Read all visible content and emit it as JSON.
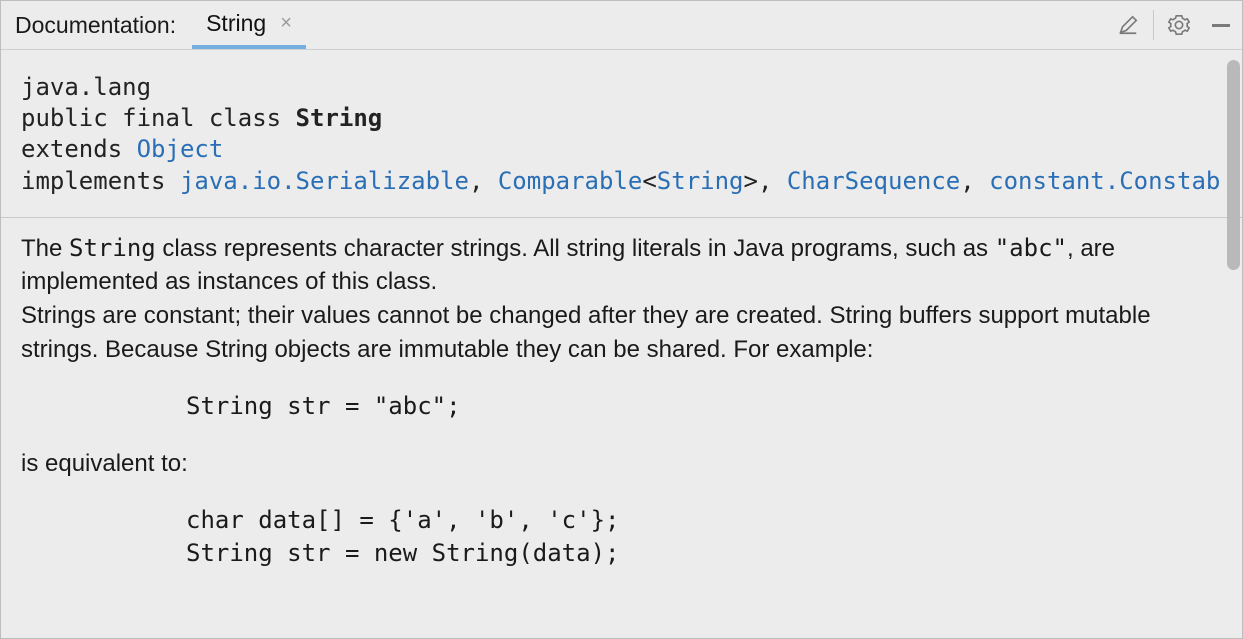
{
  "header": {
    "title": "Documentation:",
    "tab_label": "String"
  },
  "signature": {
    "package": "java.lang",
    "modifiers": "public final class",
    "class_name": "String",
    "extends_kw": "extends",
    "extends_link": "Object",
    "implements_kw": "implements",
    "impl1": "java.io.Serializable",
    "comma": ", ",
    "impl2": "Comparable",
    "lt": "<",
    "impl2_param": "String",
    "gt": ">",
    "impl3": "CharSequence",
    "impl4": "constant.Constab"
  },
  "desc": {
    "p1a": "The ",
    "p1code": "String",
    "p1b": " class represents character strings. All string literals in Java programs, such as ",
    "p1lit": "\"abc\"",
    "p1c": ", are implemented as instances of this class.",
    "p2": "Strings are constant; their values cannot be changed after they are created. String buffers support mutable strings. Because String objects are immutable they can be shared. For example:",
    "code1": "String str = \"abc\";",
    "p3": "is equivalent to:",
    "code2": "char data[] = {'a', 'b', 'c'};\nString str = new String(data);"
  }
}
